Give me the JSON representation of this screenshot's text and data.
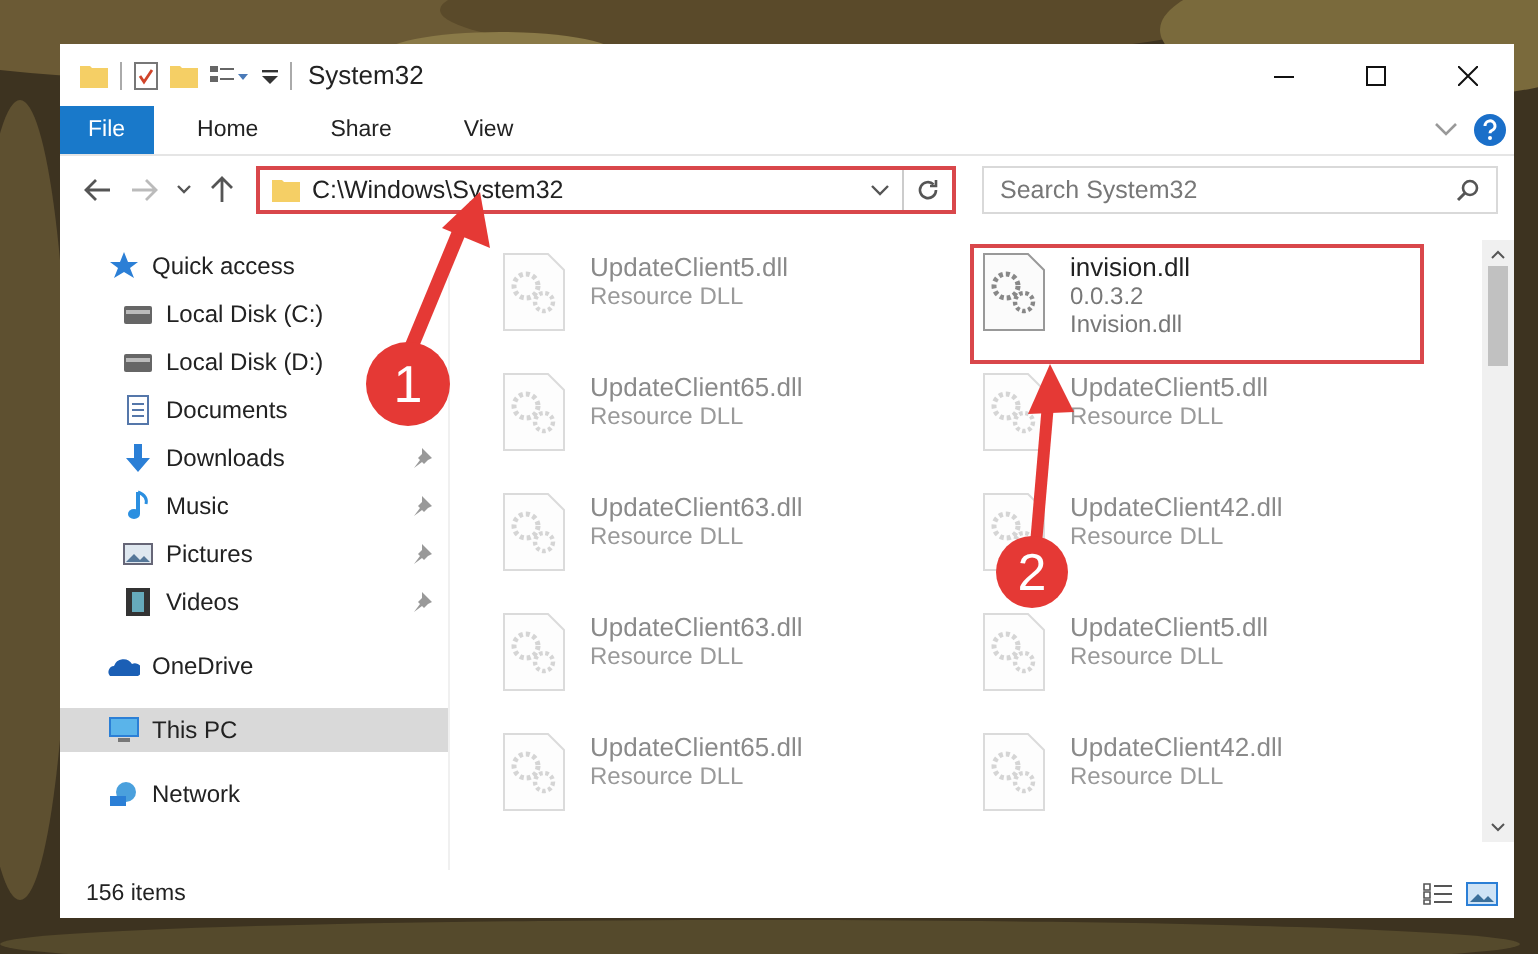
{
  "window": {
    "title": "System32"
  },
  "ribbon_tabs": [
    {
      "label": "File",
      "kind": "file",
      "selected": false
    },
    {
      "label": "Home",
      "kind": "tab",
      "selected": false
    },
    {
      "label": "Share",
      "kind": "tab",
      "selected": false
    },
    {
      "label": "View",
      "kind": "tab",
      "selected": false
    }
  ],
  "address_bar": {
    "path": "C:\\Windows\\System32",
    "highlighted": true
  },
  "search": {
    "placeholder": "Search System32"
  },
  "sidebar": {
    "items": [
      {
        "label": "Quick access",
        "kind": "star",
        "selected": false,
        "children": [
          {
            "label": "Local Disk (C:)",
            "kind": "drive",
            "pinned": false,
            "selected": false
          },
          {
            "label": "Local Disk (D:)",
            "kind": "drive",
            "pinned": false,
            "selected": false
          },
          {
            "label": "Documents",
            "kind": "doc",
            "pinned": false,
            "selected": false
          },
          {
            "label": "Downloads",
            "kind": "download",
            "pinned": true,
            "selected": false
          },
          {
            "label": "Music",
            "kind": "music",
            "pinned": true,
            "selected": false
          },
          {
            "label": "Pictures",
            "kind": "pictures",
            "pinned": true,
            "selected": false
          },
          {
            "label": "Videos",
            "kind": "videos",
            "pinned": true,
            "selected": false
          }
        ]
      },
      {
        "label": "OneDrive",
        "kind": "cloud",
        "selected": false
      },
      {
        "label": "This PC",
        "kind": "pc",
        "selected": true
      },
      {
        "label": "Network",
        "kind": "network",
        "selected": false
      }
    ]
  },
  "files": [
    {
      "name": "UpdateClient5.dll",
      "type": "Resource DLL",
      "highlighted": false,
      "dimmed": true
    },
    {
      "name": "invision.dll",
      "version": "0.0.3.2",
      "type": "Invision.dll",
      "highlighted": true,
      "dimmed": false
    },
    {
      "name": "UpdateClient65.dll",
      "type": "Resource DLL",
      "highlighted": false,
      "dimmed": true
    },
    {
      "name": "UpdateClient5.dll",
      "type": "Resource DLL",
      "highlighted": false,
      "dimmed": true
    },
    {
      "name": "UpdateClient63.dll",
      "type": "Resource DLL",
      "highlighted": false,
      "dimmed": true
    },
    {
      "name": "UpdateClient42.dll",
      "type": "Resource DLL",
      "highlighted": false,
      "dimmed": true
    },
    {
      "name": "UpdateClient63.dll",
      "type": "Resource DLL",
      "highlighted": false,
      "dimmed": true
    },
    {
      "name": "UpdateClient5.dll",
      "type": "Resource DLL",
      "highlighted": false,
      "dimmed": true
    },
    {
      "name": "UpdateClient65.dll",
      "type": "Resource DLL",
      "highlighted": false,
      "dimmed": true
    },
    {
      "name": "UpdateClient42.dll",
      "type": "Resource DLL",
      "highlighted": false,
      "dimmed": true
    }
  ],
  "status_bar": {
    "item_count": "156 items"
  },
  "annotations": [
    {
      "label": "1"
    },
    {
      "label": "2"
    }
  ]
}
